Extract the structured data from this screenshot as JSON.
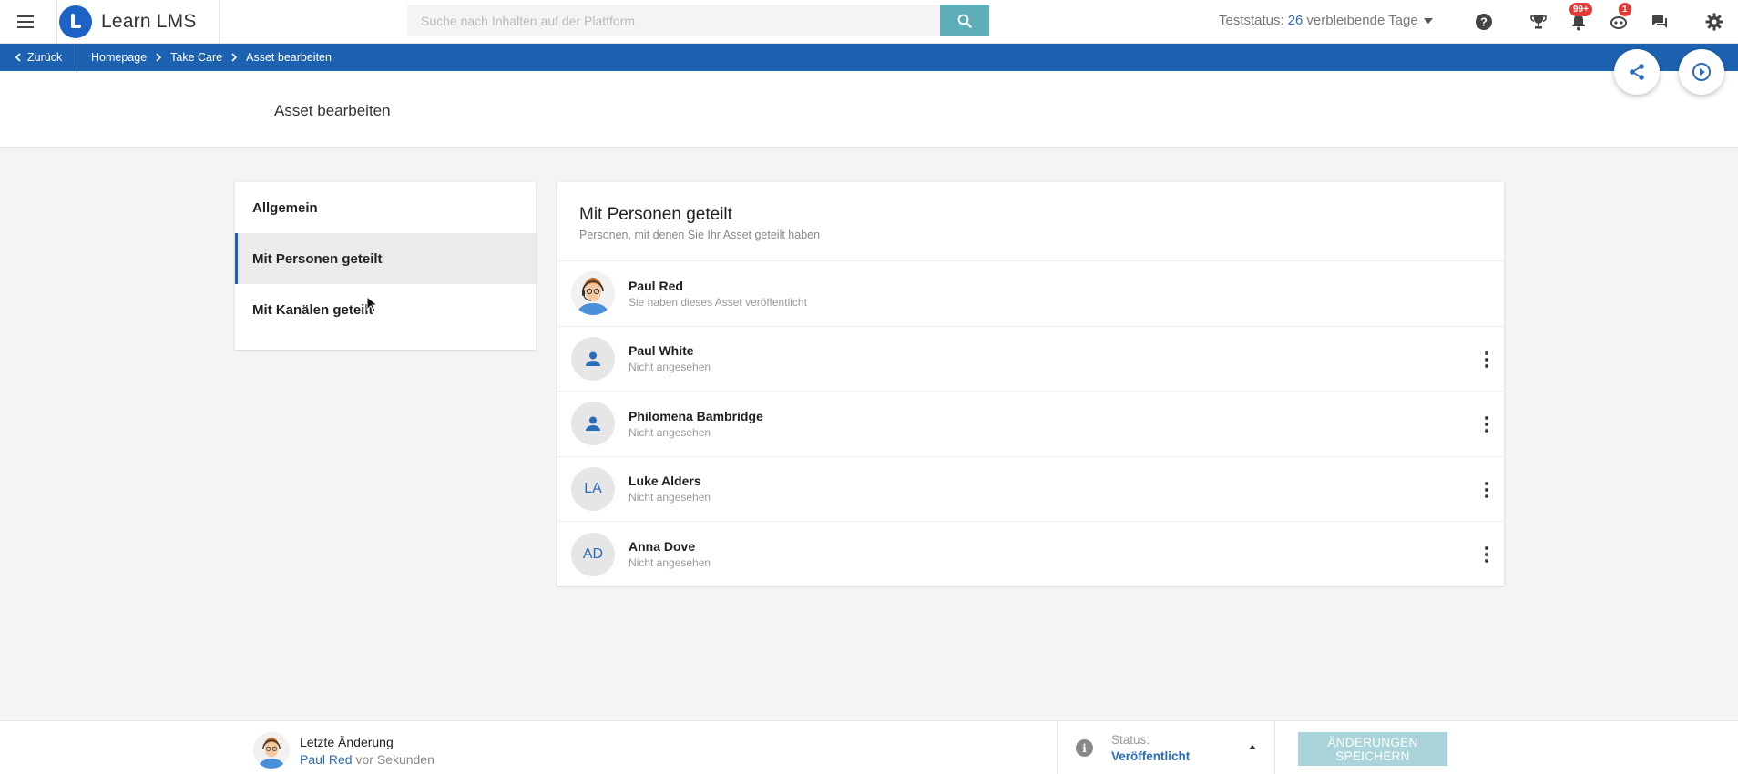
{
  "app": {
    "name": "Learn LMS"
  },
  "search": {
    "placeholder": "Suche nach Inhalten auf der Plattform"
  },
  "test_status": {
    "prefix": "Teststatus:",
    "days": "26",
    "suffix": "verbleibende Tage"
  },
  "badges": {
    "notifications": "99+",
    "messages": "1"
  },
  "breadcrumb": {
    "back": "Zurück",
    "items": [
      "Homepage",
      "Take Care",
      "Asset bearbeiten"
    ]
  },
  "page": {
    "title": "Asset bearbeiten"
  },
  "nav": {
    "items": [
      {
        "label": "Allgemein"
      },
      {
        "label": "Mit Personen geteilt"
      },
      {
        "label": "Mit Kanälen geteilt"
      }
    ],
    "active_index": 1
  },
  "shared": {
    "title": "Mit Personen geteilt",
    "subtitle": "Personen, mit denen Sie Ihr Asset geteilt haben",
    "people": [
      {
        "name": "Paul Red",
        "status": "Sie haben dieses Asset veröffentlicht",
        "avatar": "photo"
      },
      {
        "name": "Paul White",
        "status": "Nicht angesehen",
        "avatar": "person-icon"
      },
      {
        "name": "Philomena Bambridge",
        "status": "Nicht angesehen",
        "avatar": "person-icon"
      },
      {
        "name": "Luke Alders",
        "status": "Nicht angesehen",
        "avatar": "LA"
      },
      {
        "name": "Anna Dove",
        "status": "Nicht angesehen",
        "avatar": "AD"
      }
    ]
  },
  "footer": {
    "last_change_label": "Letzte Änderung",
    "last_change_user": "Paul Red",
    "last_change_time": "vor Sekunden",
    "status_label": "Status:",
    "status_value": "Veröffentlicht",
    "save_button": "ÄNDERUNGEN SPEICHERN"
  },
  "colors": {
    "primary": "#1d62b0",
    "search_button": "#5eaeb9",
    "badge": "#e53935",
    "save_button_disabled": "#a9d4da",
    "link": "#2b6cb8"
  }
}
